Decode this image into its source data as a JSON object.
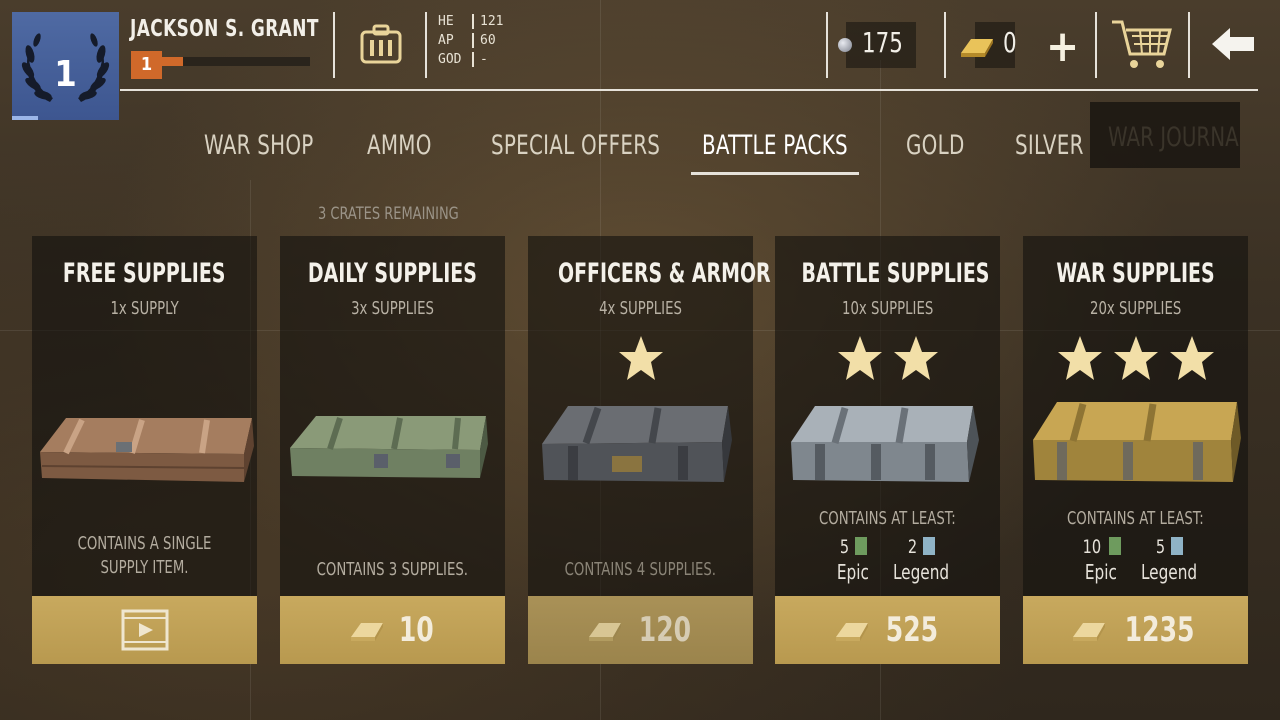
{
  "player": {
    "name": "JACKSON S. GRANT",
    "rank": "1",
    "level": "1",
    "xp_fraction": 0.14
  },
  "stats": [
    {
      "key": "HE",
      "value": "121"
    },
    {
      "key": "AP",
      "value": "60"
    },
    {
      "key": "GOD",
      "value": "-"
    }
  ],
  "currency": {
    "silver": "175",
    "gold": "0"
  },
  "icons": {
    "ammo": "ammo-crate-icon",
    "silver": "silver-coin-icon",
    "gold": "gold-bar-icon",
    "add": "plus-icon",
    "cart": "shopping-cart-icon",
    "back": "back-arrow-icon"
  },
  "tabs": [
    {
      "label": "WAR SHOP",
      "active": false
    },
    {
      "label": "AMMO",
      "active": false
    },
    {
      "label": "SPECIAL OFFERS",
      "active": false
    },
    {
      "label": "BATTLE PACKS",
      "active": true
    },
    {
      "label": "GOLD",
      "active": false
    },
    {
      "label": "SILVER",
      "active": false
    },
    {
      "label": "WAR JOURNAL",
      "active": false
    }
  ],
  "crates_remaining": "3 CRATES REMAINING",
  "cards": [
    {
      "title": "FREE SUPPLIES",
      "subtitle": "1x SUPPLY",
      "stars": 0,
      "description": "CONTAINS A SINGLE SUPPLY ITEM.",
      "price": "",
      "price_type": "video",
      "crate_color": "wood"
    },
    {
      "title": "DAILY SUPPLIES",
      "subtitle": "3x SUPPLIES",
      "stars": 0,
      "description": "CONTAINS 3 SUPPLIES.",
      "price": "10",
      "price_type": "gold",
      "crate_color": "green"
    },
    {
      "title": "OFFICERS & ARMOR",
      "subtitle": "4x SUPPLIES",
      "stars": 1,
      "description": "CONTAINS 4 SUPPLIES.",
      "price": "120",
      "price_type": "gold",
      "crate_color": "grey"
    },
    {
      "title": "BATTLE SUPPLIES",
      "subtitle": "10x SUPPLIES",
      "stars": 2,
      "contains_label": "CONTAINS AT LEAST:",
      "epic_count": "5",
      "epic_label": "Epic",
      "legend_count": "2",
      "legend_label": "Legend",
      "price": "525",
      "price_type": "gold",
      "crate_color": "steel"
    },
    {
      "title": "WAR SUPPLIES",
      "subtitle": "20x SUPPLIES",
      "stars": 3,
      "contains_label": "CONTAINS AT LEAST:",
      "epic_count": "10",
      "epic_label": "Epic",
      "legend_count": "5",
      "legend_label": "Legend",
      "price": "1235",
      "price_type": "gold",
      "crate_color": "yellow"
    }
  ],
  "colors": {
    "rank_blue": "#4f6aa3",
    "level_orange": "#d0692a",
    "price_gold": "#c8a95e",
    "epic_green": "#6e9b5e",
    "legend_blue": "#8fb3c6",
    "star_gold": "#f2dfa8"
  }
}
